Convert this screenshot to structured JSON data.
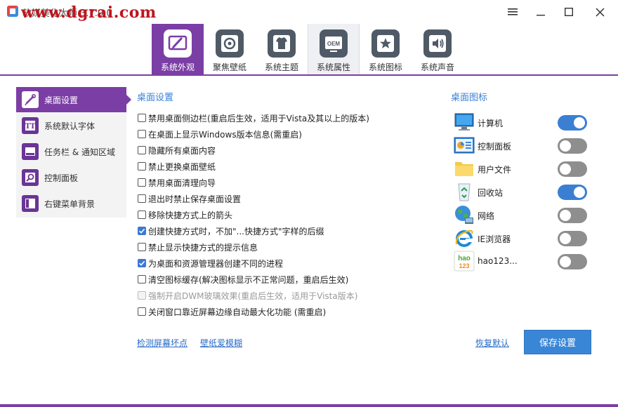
{
  "window": {
    "title": "软媒美化大师 3.7.0.0",
    "watermark": "www.dgrai.com",
    "controls": {
      "menu": "menu-icon",
      "minimize": "minimize-icon",
      "maximize": "maximize-icon",
      "close": "close-icon"
    }
  },
  "topnav": {
    "tabs": [
      {
        "label": "系统外观",
        "icon": "brush-icon",
        "state": "active"
      },
      {
        "label": "聚焦壁纸",
        "icon": "focus-wallpaper-icon",
        "state": "normal"
      },
      {
        "label": "系统主题",
        "icon": "shirt-icon",
        "state": "normal"
      },
      {
        "label": "系统属性",
        "icon": "oem-icon",
        "state": "hover"
      },
      {
        "label": "系统图标",
        "icon": "star-icon",
        "state": "normal"
      },
      {
        "label": "系统声音",
        "icon": "speaker-icon",
        "state": "normal"
      }
    ]
  },
  "sidebar": {
    "items": [
      {
        "label": "桌面设置",
        "icon": "desktop-brush-icon",
        "active": true
      },
      {
        "label": "系统默认字体",
        "icon": "font-icon",
        "active": false
      },
      {
        "label": "任务栏 & 通知区域",
        "icon": "taskbar-icon",
        "active": false
      },
      {
        "label": "控制面板",
        "icon": "control-panel-icon",
        "active": false
      },
      {
        "label": "右键菜单背景",
        "icon": "context-menu-icon",
        "active": false
      }
    ]
  },
  "desktop_settings": {
    "title": "桌面设置",
    "options": [
      {
        "label": "禁用桌面侧边栏(重启后生效，适用于Vista及其以上的版本)",
        "checked": false,
        "disabled": false
      },
      {
        "label": "在桌面上显示Windows版本信息(需重启)",
        "checked": false,
        "disabled": false
      },
      {
        "label": "隐藏所有桌面内容",
        "checked": false,
        "disabled": false
      },
      {
        "label": "禁止更换桌面壁纸",
        "checked": false,
        "disabled": false
      },
      {
        "label": "禁用桌面清理向导",
        "checked": false,
        "disabled": false
      },
      {
        "label": "退出时禁止保存桌面设置",
        "checked": false,
        "disabled": false
      },
      {
        "label": "移除快捷方式上的箭头",
        "checked": false,
        "disabled": false
      },
      {
        "label": "创建快捷方式时，不加\"...快捷方式\"字样的后缀",
        "checked": true,
        "disabled": false
      },
      {
        "label": "禁止显示快捷方式的提示信息",
        "checked": false,
        "disabled": false
      },
      {
        "label": "为桌面和资源管理器创建不同的进程",
        "checked": true,
        "disabled": false
      },
      {
        "label": "清空图标缓存(解决图标显示不正常问题，重启后生效)",
        "checked": false,
        "disabled": false
      },
      {
        "label": "强制开启DWM玻璃效果(重启后生效，适用于Vista版本)",
        "checked": false,
        "disabled": true
      },
      {
        "label": "关闭窗口靠近屏幕边缘自动最大化功能 (需重启)",
        "checked": false,
        "disabled": false
      }
    ],
    "links": {
      "check_pixels": "检测屏幕坏点",
      "wallpaper_blur": "壁纸爱模糊"
    }
  },
  "desktop_icons": {
    "title": "桌面图标",
    "items": [
      {
        "label": "计算机",
        "icon": "computer-icon",
        "enabled": true
      },
      {
        "label": "控制面板",
        "icon": "control-panel-desktop-icon",
        "enabled": false
      },
      {
        "label": "用户文件",
        "icon": "folder-icon",
        "enabled": false
      },
      {
        "label": "回收站",
        "icon": "recycle-bin-icon",
        "enabled": true
      },
      {
        "label": "网络",
        "icon": "network-globe-icon",
        "enabled": false
      },
      {
        "label": "IE浏览器",
        "icon": "ie-browser-icon",
        "enabled": false
      },
      {
        "label": "hao123...",
        "icon": "hao123-icon",
        "enabled": false
      }
    ]
  },
  "actions": {
    "restore_default": "恢复默认",
    "save": "保存设置"
  },
  "colors": {
    "accent": "#7b3ea5",
    "link": "#2a6cc8",
    "toggle_on": "#3b7fd3",
    "toggle_off": "#8e8e8e",
    "primary_button": "#3a86d6"
  }
}
